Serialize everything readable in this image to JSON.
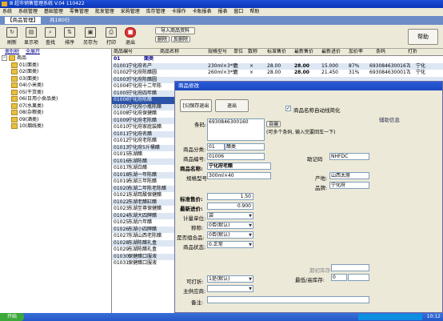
{
  "window": {
    "title": "Ⅲ 超市销售管理系统 V.04 110422"
  },
  "menu": [
    "系统",
    "系统管理",
    "基础管理",
    "零售管理",
    "批发管理",
    "采购管理",
    "库存管理",
    "卡操作",
    "卡账报表",
    "报表",
    "窗口",
    "帮助"
  ],
  "doc_tab": {
    "label": "【商品管理】",
    "summary": "共180行"
  },
  "toolbar": {
    "buttons": [
      {
        "label": "刷新",
        "icon": "refresh-icon"
      },
      {
        "label": "显示项",
        "icon": "columns-icon"
      },
      {
        "label": "查找",
        "icon": "search-icon"
      },
      {
        "label": "排序",
        "icon": "sort-icon"
      },
      {
        "label": "另存为",
        "icon": "save-icon"
      },
      {
        "label": "打印",
        "icon": "print-icon"
      },
      {
        "label": "退出",
        "icon": "exit-icon"
      }
    ],
    "import_label": "导入商品资料",
    "delete_label": "删除",
    "reverse_delete_label": "反删除",
    "help_label": "帮助"
  },
  "left_tabs": [
    "类别树",
    "全展开"
  ],
  "tree": {
    "root": "商品",
    "children": [
      "01(面类)",
      "02(面类)",
      "03(面类)",
      "04(小米类)",
      "05(干货类)",
      "06(日用小食品类)",
      "07(水果类)",
      "08(杂粮类)",
      "09(酒类)",
      "10(烟线类)"
    ]
  },
  "grid": {
    "columns": [
      "商品编号",
      "商品名称",
      "规格型号",
      "单位",
      "数称",
      "标准售价",
      "最新售价",
      "最新进价",
      "加价率",
      "条码",
      "打折"
    ],
    "group_row": {
      "code": "01",
      "name": "面类"
    },
    "rows": [
      {
        "code": "01001",
        "name": "宁化府名产",
        "spec": "230ml×3*5",
        "unit": "盒",
        "flag": "×",
        "std": "28.00",
        "new": "28.00",
        "cost": "15.000",
        "rate": "87%",
        "barcode": "6930846300167",
        "disc": "1",
        "extra": "宁化"
      },
      {
        "code": "01002",
        "name": "宁化府陈醋圆",
        "spec": "260ml×3*5",
        "unit": "盒",
        "flag": "×",
        "std": "28.00",
        "new": "28.00",
        "cost": "21.450",
        "rate": "31%",
        "barcode": "6930846300017",
        "disc": "1",
        "extra": "宁化"
      },
      {
        "code": "01003",
        "name": "宁化府陈醋圆"
      },
      {
        "code": "01004",
        "name": "宁化府十二年陈"
      },
      {
        "code": "01005",
        "name": "宁化府四年醋"
      },
      {
        "code": "01006",
        "name": "宁化府陈醋"
      },
      {
        "code": "01007",
        "name": "宁化府小瓶陈醋"
      },
      {
        "code": "01008",
        "name": "宁化府保健醋"
      },
      {
        "code": "01009",
        "name": "宁化府老陈醋"
      },
      {
        "code": "01010",
        "name": "宁化府家庭装醋"
      },
      {
        "code": "01011",
        "name": "宁化府名醋"
      },
      {
        "code": "01012",
        "name": "宁化府老陈醋"
      },
      {
        "code": "01013",
        "name": "宁化府5斤桶醋"
      },
      {
        "code": "01015",
        "name": "东湖醋"
      },
      {
        "code": "01016",
        "name": "东湖陈醋"
      },
      {
        "code": "01017",
        "name": "东湖白醋"
      },
      {
        "code": "01018",
        "name": "东湖一年陈醋"
      },
      {
        "code": "01019",
        "name": "东湖三年陈醋"
      },
      {
        "code": "01020",
        "name": "东湖二年陈老陈醋"
      },
      {
        "code": "01021",
        "name": "东湖耳酸保健醋"
      },
      {
        "code": "01022",
        "name": "东湖老醋缸醋"
      },
      {
        "code": "01023",
        "name": "东湖至尊保健醋"
      },
      {
        "code": "01024",
        "name": "东湖大四牌醋"
      },
      {
        "code": "01025",
        "name": "东湖六年醋"
      },
      {
        "code": "01026",
        "name": "东湖小四牌醋"
      },
      {
        "code": "01027",
        "name": "东湖山西老陈醋"
      },
      {
        "code": "01028",
        "name": "东湖陈醋礼盒"
      },
      {
        "code": "01029",
        "name": "东湖陈醋礼盒"
      },
      {
        "code": "01030",
        "name": "保健醋口服液"
      },
      {
        "code": "01031",
        "name": "保健醋口服液"
      }
    ]
  },
  "dialog": {
    "title": "商品修改",
    "save_exit": "[S]保存退出",
    "exit": "退出",
    "auto_abbrev_label": "商品名称自动线简化",
    "auto_abbrev_checked": true,
    "aux_title": "辅助信息",
    "barcode_label": "条码:",
    "barcode_value": "6930846300160",
    "auto_code_btn": "自编",
    "barcode_hint": "(可多个条码, 输入完要回车一下)",
    "category_label": "商品分类:",
    "category_code": "01",
    "category_name": "醋类",
    "code_label": "商品编号:",
    "code_value": "01006",
    "mnemonic_label": "助记码",
    "mnemonic_value": "NHFDC",
    "name_label": "商品名称:",
    "name_value": "宁化府老醋",
    "spec_label": "规格型号",
    "spec_value": "300ml×40",
    "origin_label": "产地:",
    "origin_value": "山西太原",
    "brand_label": "品牌:",
    "brand_value": "宁化府",
    "std_price_label": "标准售价:",
    "std_price_value": "1.50",
    "new_cost_label": "最新进价:",
    "new_cost_value": "0.900",
    "unit_label": "计量单位:",
    "unit_value": "袋",
    "weigh_label": "称称:",
    "weigh_value": "0否(默认)",
    "combo_label": "是否组合品:",
    "combo_value": "0否(默认)",
    "status_label": "商品状态:",
    "status_value": "0.正常",
    "period_stock_label": "期初库存:",
    "min_max_label": "最低/高库存:",
    "min_stock_value": "0",
    "printable_label": "可打折:",
    "printable_value": "1是(默认)",
    "supplier_label": "主供应商:",
    "remark_label": "备注:"
  },
  "taskbar": {
    "start": "开始",
    "clock": "10:12"
  }
}
